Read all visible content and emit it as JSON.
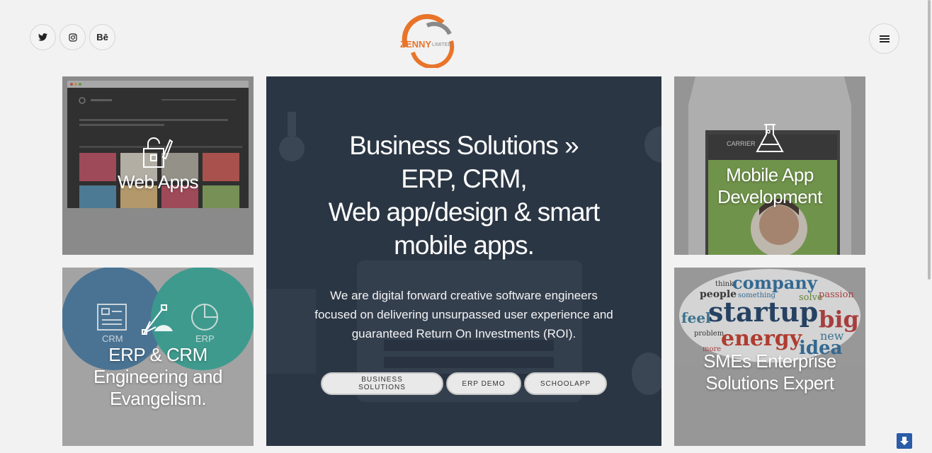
{
  "header": {
    "social": [
      {
        "name": "twitter-icon",
        "glyph": "🐦"
      },
      {
        "name": "instagram-icon",
        "glyph": "◎"
      },
      {
        "name": "behance-icon",
        "glyph": "Bē"
      }
    ],
    "logo_main": "ZENNY",
    "logo_sub": "LIMITED",
    "menu_icon": "hamburger-icon"
  },
  "tiles": {
    "web": {
      "title": "Web Apps",
      "icon": "lock-pencil-icon"
    },
    "mobile": {
      "title_line1": "Mobile App",
      "title_line2": "Development",
      "icon": "flask-icon",
      "carrier": "CARRIER"
    },
    "erp": {
      "title_line1": "ERP & CRM",
      "title_line2": "Engineering and",
      "title_line3": "Evangelism.",
      "icon": "vector-pen-icon",
      "label_crm": "CRM",
      "label_erp": "ERP"
    },
    "sme": {
      "title_line1": "SMEs Enterprise",
      "title_line2": "Solutions Expert",
      "words": {
        "company": "company",
        "startup": "startup",
        "big": "big",
        "energy": "energy",
        "idea": "idea",
        "feel": "feel",
        "people": "people",
        "new": "new",
        "passion": "passion",
        "solve": "solve",
        "think": "think",
        "something": "something",
        "more": "more",
        "problem": "problem"
      }
    }
  },
  "hero": {
    "title_line1": "Business Solutions »",
    "title_line2": "ERP, CRM,",
    "title_line3": "Web app/design & smart",
    "title_line4": "mobile apps.",
    "text": "We are digital forward creative software engineers focused on delivering unsurpassed user experience and guaranteed Return On Investments (ROI).",
    "buttons": [
      "BUSINESS SOLUTIONS",
      "ERP DEMO",
      "SCHOOLAPP"
    ]
  },
  "scroll_down_icon": "arrow-down-icon",
  "colors": {
    "accent_orange": "#e8742a",
    "logo_gray": "#888888",
    "hero_bg": "#2d3846",
    "scroll_btn": "#2a5ca8"
  }
}
